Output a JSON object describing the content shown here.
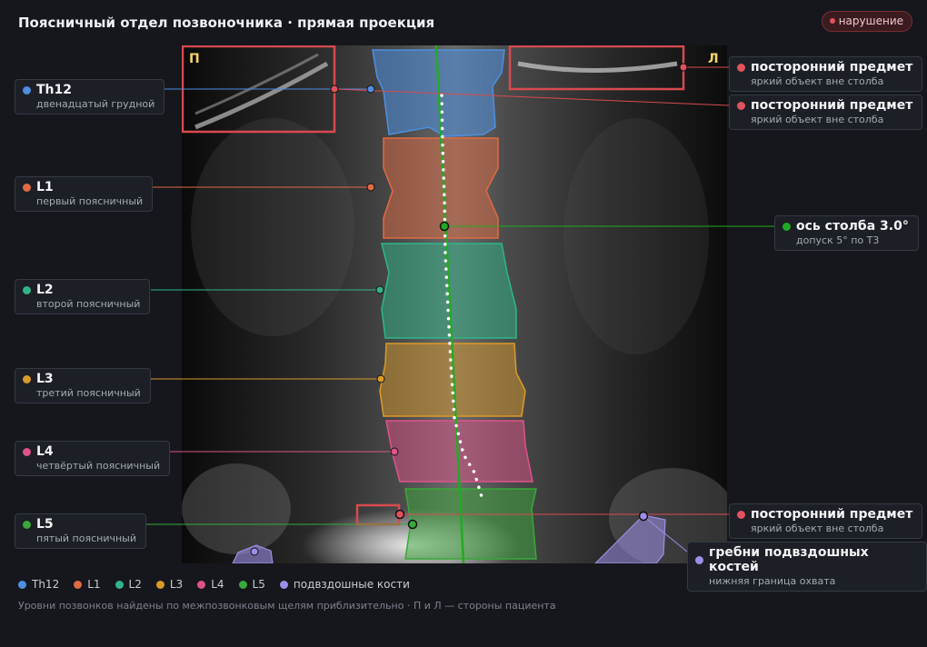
{
  "header": {
    "title": "Поясничный отдел позвоночника · прямая проекция",
    "status_label": "нарушение"
  },
  "orientation": {
    "right_mark": "П",
    "left_mark": "Л"
  },
  "colors": {
    "Th12": "#4e8fe0",
    "L1": "#e06b43",
    "L2": "#2fb58a",
    "L3": "#d99a2b",
    "L4": "#e0528a",
    "L5": "#3aa83a",
    "ilium": "#9d8fe8",
    "alert": "#e2525c",
    "axis": "#22aa22"
  },
  "vertebra_callouts": [
    {
      "id": "Th12",
      "name": "Th12",
      "desc": "двенадцатый грудной"
    },
    {
      "id": "L1",
      "name": "L1",
      "desc": "первый поясничный"
    },
    {
      "id": "L2",
      "name": "L2",
      "desc": "второй поясничный"
    },
    {
      "id": "L3",
      "name": "L3",
      "desc": "третий поясничный"
    },
    {
      "id": "L4",
      "name": "L4",
      "desc": "четвёртый поясничный"
    },
    {
      "id": "L5",
      "name": "L5",
      "desc": "пятый поясничный"
    }
  ],
  "right_callouts": [
    {
      "id": "fb1",
      "name": "посторонний предмет",
      "desc": "яркий объект вне столба"
    },
    {
      "id": "fb2",
      "name": "посторонний предмет",
      "desc": "яркий объект вне столба"
    },
    {
      "id": "axis",
      "name": "ось столба 3.0°",
      "desc": "допуск 5° по Т3"
    },
    {
      "id": "fb3",
      "name": "посторонний предмет",
      "desc": "яркий объект вне столба"
    },
    {
      "id": "ilium",
      "name": "гребни подвздошных костей",
      "desc": "нижняя граница охвата"
    }
  ],
  "legend": [
    "Th12",
    "L1",
    "L2",
    "L3",
    "L4",
    "L5",
    "подвздошные кости"
  ],
  "footnote": "Уровни позвонков найдены по межпозвонковым щелям приблизительно · П и Л — стороны пациента"
}
